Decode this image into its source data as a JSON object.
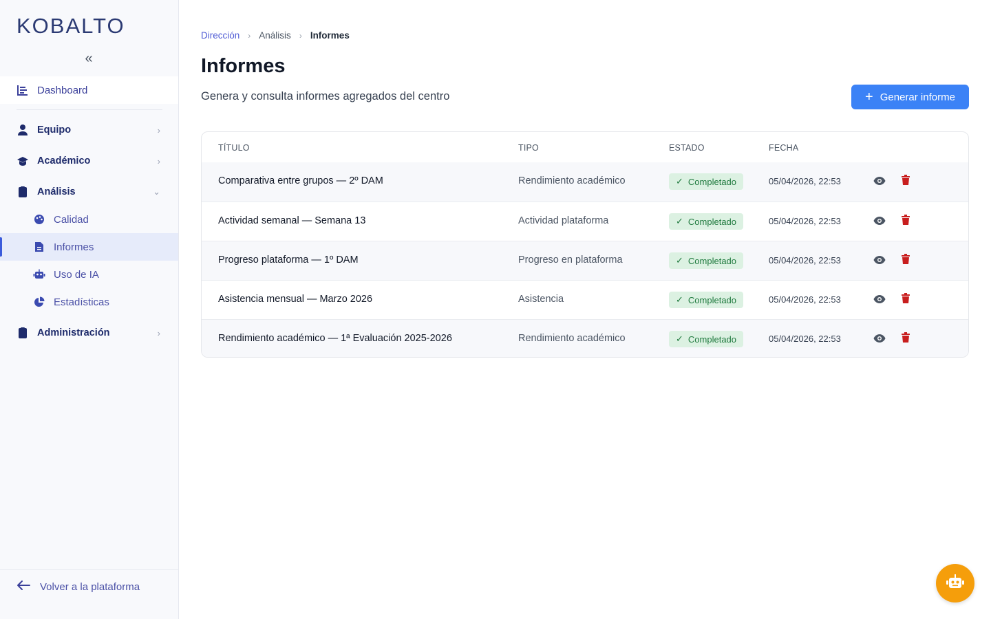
{
  "app": {
    "logo": "KOBALTO"
  },
  "sidebar": {
    "collapse_icon": "chevrons-left-icon",
    "dashboard": {
      "label": "Dashboard",
      "icon": "chart-bar-icon"
    },
    "sections": [
      {
        "label": "Equipo",
        "icon": "user-tie-icon"
      },
      {
        "label": "Académico",
        "icon": "graduation-cap-icon"
      },
      {
        "label": "Análisis",
        "icon": "clipboard-icon"
      },
      {
        "label": "Administración",
        "icon": "clipboard-icon"
      }
    ],
    "analysis_items": [
      {
        "label": "Calidad",
        "icon": "palette-icon"
      },
      {
        "label": "Informes",
        "icon": "file-text-icon",
        "active": true
      },
      {
        "label": "Uso de IA",
        "icon": "robot-icon"
      },
      {
        "label": "Estadísticas",
        "icon": "pie-chart-icon"
      }
    ],
    "back_label": "Volver a la plataforma"
  },
  "breadcrumb": [
    "Dirección",
    "Análisis",
    "Informes"
  ],
  "page": {
    "title": "Informes",
    "subtitle": "Genera y consulta informes agregados del centro",
    "generate_button": "Generar informe"
  },
  "table": {
    "headers": [
      "TÍTULO",
      "TIPO",
      "ESTADO",
      "FECHA"
    ],
    "rows": [
      {
        "title": "Comparativa entre grupos — 2º DAM",
        "type": "Rendimiento académico",
        "status": "Completado",
        "date": "05/04/2026, 22:53"
      },
      {
        "title": "Actividad semanal — Semana 13",
        "type": "Actividad plataforma",
        "status": "Completado",
        "date": "05/04/2026, 22:53"
      },
      {
        "title": "Progreso plataforma — 1º DAM",
        "type": "Progreso en plataforma",
        "status": "Completado",
        "date": "05/04/2026, 22:53"
      },
      {
        "title": "Asistencia mensual — Marzo 2026",
        "type": "Asistencia",
        "status": "Completado",
        "date": "05/04/2026, 22:53"
      },
      {
        "title": "Rendimiento académico — 1ª Evaluación 2025-2026",
        "type": "Rendimiento académico",
        "status": "Completado",
        "date": "05/04/2026, 22:53"
      }
    ]
  },
  "colors": {
    "primary": "#3b82f6",
    "brand": "#2b3a73",
    "success_bg": "#dcf1e2",
    "success_text": "#1f7a3e",
    "danger": "#c81e1e",
    "fab": "#f59e0b"
  }
}
